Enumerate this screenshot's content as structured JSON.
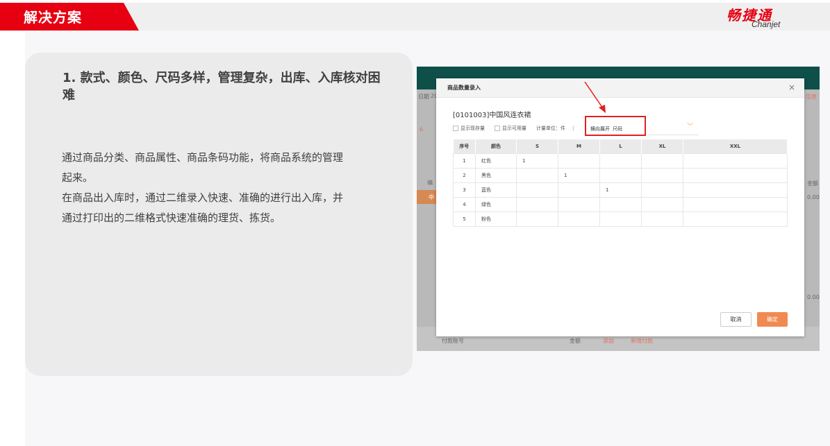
{
  "header": {
    "title": "解决方案",
    "logo_cn": "畅捷通",
    "logo_en": "Chanjet",
    "accent_color": "#e60012"
  },
  "card": {
    "title": "1. 款式、颜色、尺码多样，管理复杂，出库、入库核对困难",
    "paragraphs": [
      "通过商品分类、商品属性、商品条码功能，将商品系统的管理起来。",
      "在商品出入库时，通过二维录入快速、准确的进行出入库，并通过打印出的二维格式快速准确的理货、拣货。"
    ]
  },
  "screenshot_bg": {
    "left_texts": [
      "日期",
      "20",
      "6",
      "编",
      "中"
    ],
    "right_texts": [
      "信息",
      "金额",
      "0.00",
      "0.00"
    ],
    "bottom_texts": [
      "付款账号",
      "金额",
      "添加",
      "新增付款"
    ]
  },
  "dialog": {
    "title": "商品数量录入",
    "close_icon": "×",
    "product": "[0101003]中国风连衣裙",
    "show_stock_label": "显示现存量",
    "show_available_label": "显示可用量",
    "unit_label": "计量单位：件",
    "expand_label": "横向展开",
    "expand_value": "尺码",
    "columns": [
      "序号",
      "颜色",
      "S",
      "M",
      "L",
      "XL",
      "XXL"
    ],
    "rows": [
      [
        "1",
        "红色",
        "1",
        "",
        "",
        "",
        ""
      ],
      [
        "2",
        "黑色",
        "",
        "1",
        "",
        "",
        ""
      ],
      [
        "3",
        "蓝色",
        "",
        "",
        "1",
        "",
        ""
      ],
      [
        "4",
        "绿色",
        "",
        "",
        "",
        "",
        ""
      ],
      [
        "5",
        "粉色",
        "",
        "",
        "",
        "",
        ""
      ]
    ],
    "cancel_label": "取消",
    "ok_label": "确定",
    "ok_color": "#f08a50"
  }
}
